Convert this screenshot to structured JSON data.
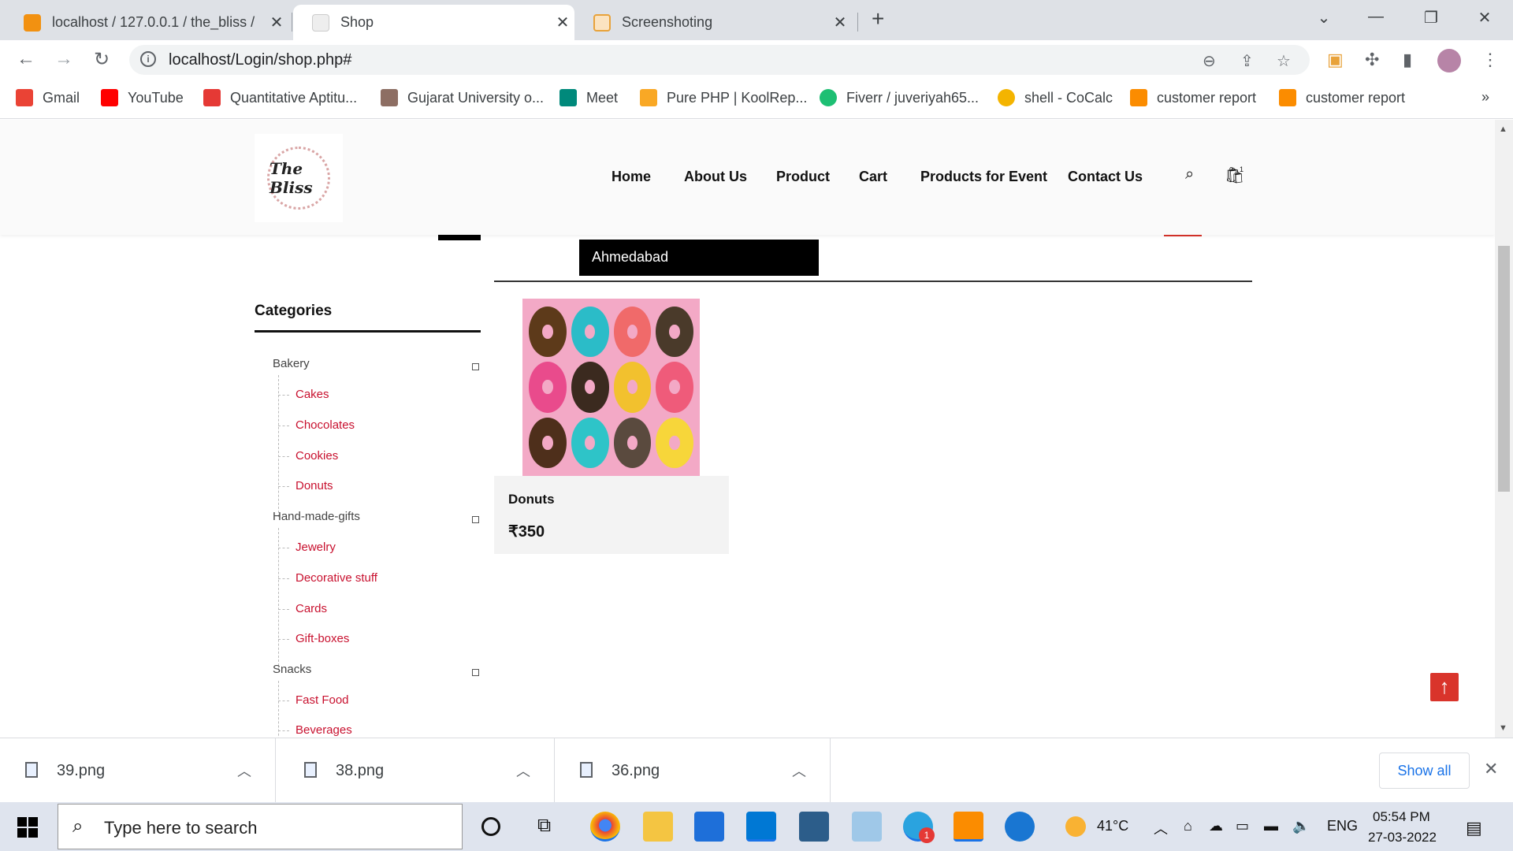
{
  "browser": {
    "tabs": [
      {
        "title": "localhost / 127.0.0.1 / the_bliss /",
        "active": false
      },
      {
        "title": "Shop",
        "active": true
      },
      {
        "title": "Screenshoting",
        "active": false
      }
    ],
    "new_tab": "+",
    "url": "localhost/Login/shop.php#",
    "bookmarks": [
      {
        "label": "Gmail",
        "color": "#ea4335"
      },
      {
        "label": "YouTube",
        "color": "#ff0000"
      },
      {
        "label": "Quantitative Aptitu...",
        "color": "#e53935"
      },
      {
        "label": "Gujarat University o...",
        "color": "#8d6e63"
      },
      {
        "label": "Meet",
        "color": "#00897b"
      },
      {
        "label": "Pure PHP | KoolRep...",
        "color": "#f9a825"
      },
      {
        "label": "Fiverr / juveriyah65...",
        "color": "#1dbf73"
      },
      {
        "label": "shell - CoCalc",
        "color": "#f4b400"
      },
      {
        "label": "customer report",
        "color": "#fb8c00"
      },
      {
        "label": "customer report",
        "color": "#fb8c00"
      }
    ],
    "more_bookmarks": "»"
  },
  "site": {
    "logo_text": "The Bliss",
    "nav": [
      "Home",
      "About Us",
      "Product",
      "Cart",
      "Products for Event",
      "Contact Us"
    ],
    "cart_count": "1",
    "location": "Ahmedabad",
    "categories_heading": "Categories",
    "categories": [
      {
        "name": "Bakery",
        "children": [
          "Cakes",
          "Chocolates",
          "Cookies",
          "Donuts"
        ]
      },
      {
        "name": "Hand-made-gifts",
        "children": [
          "Jewelry",
          "Decorative stuff",
          "Cards",
          "Gift-boxes"
        ]
      },
      {
        "name": "Snacks",
        "children": [
          "Fast Food",
          "Beverages"
        ]
      }
    ],
    "product": {
      "name": "Donuts",
      "price": "₹350"
    },
    "to_top_icon": "arrow-up-icon",
    "accent_color": "#d9342b"
  },
  "downloads": {
    "items": [
      "39.png",
      "38.png",
      "36.png"
    ],
    "show_all": "Show all"
  },
  "taskbar": {
    "search_placeholder": "Type here to search",
    "temperature": "41°C",
    "language": "ENG",
    "time": "05:54 PM",
    "date": "27-03-2022",
    "notification_badge": "1"
  }
}
